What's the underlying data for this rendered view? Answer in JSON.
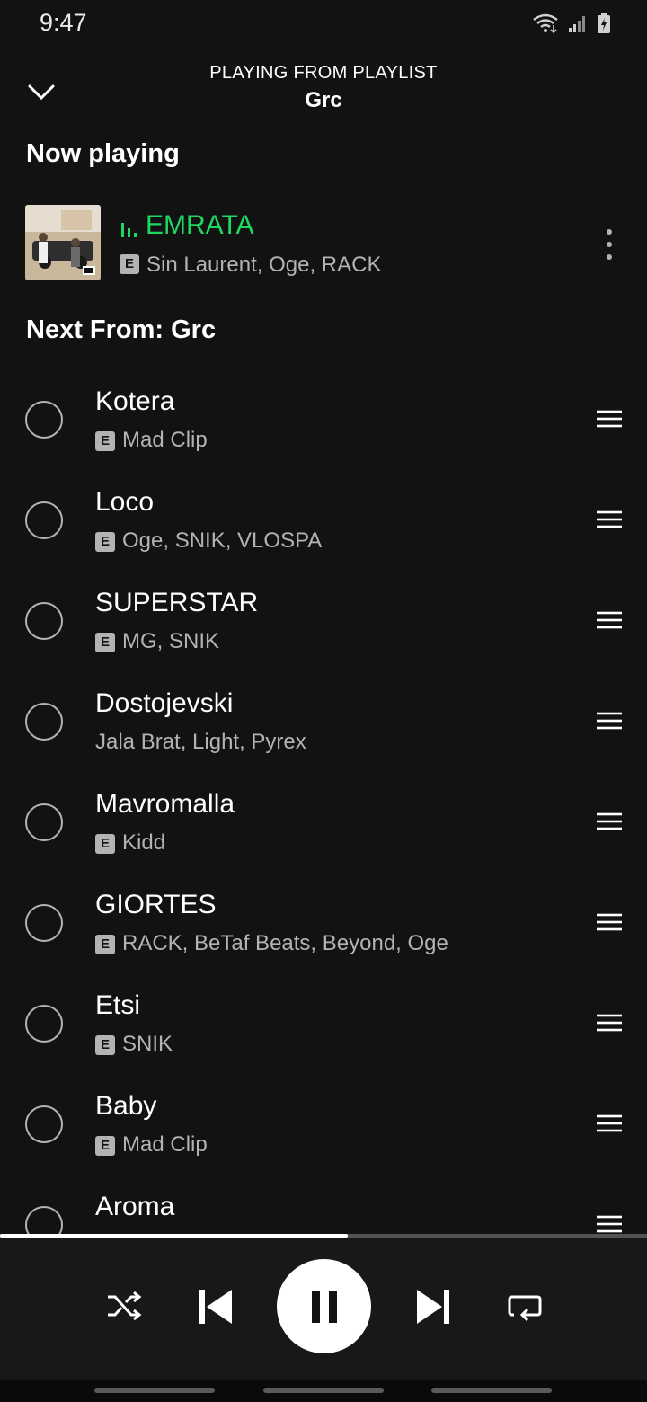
{
  "status": {
    "time": "9:47"
  },
  "header": {
    "context_label": "PLAYING FROM PLAYLIST",
    "playlist_name": "Grc"
  },
  "now_playing": {
    "section_title": "Now playing",
    "title": "EMRATA",
    "explicit_badge": "E",
    "artists": "Sin Laurent, Oge, RACK"
  },
  "next": {
    "section_title": "Next From: Grc",
    "items": [
      {
        "title": "Kotera",
        "explicit": true,
        "badge": "E",
        "artists": "Mad Clip"
      },
      {
        "title": "Loco",
        "explicit": true,
        "badge": "E",
        "artists": "Oge, SNIK, VLOSPA"
      },
      {
        "title": "SUPERSTAR",
        "explicit": true,
        "badge": "E",
        "artists": "MG, SNIK"
      },
      {
        "title": "Dostojevski",
        "explicit": false,
        "badge": "",
        "artists": "Jala Brat, Light, Pyrex"
      },
      {
        "title": "Mavromalla",
        "explicit": true,
        "badge": "E",
        "artists": "Kidd"
      },
      {
        "title": "GIORTES",
        "explicit": true,
        "badge": "E",
        "artists": "RACK, BeTaf Beats, Beyond, Oge"
      },
      {
        "title": "Etsi",
        "explicit": true,
        "badge": "E",
        "artists": "SNIK"
      },
      {
        "title": "Baby",
        "explicit": true,
        "badge": "E",
        "artists": "Mad Clip"
      },
      {
        "title": "Aroma",
        "explicit": false,
        "badge": "",
        "artists": ""
      }
    ]
  },
  "player": {
    "progress_fraction": 0.537,
    "controls": [
      "shuffle-icon",
      "previous-icon",
      "pause-icon",
      "next-icon",
      "repeat-icon"
    ]
  },
  "colors": {
    "background": "#121212",
    "accent_green": "#1ed760",
    "secondary_text": "#b3b3b3"
  }
}
